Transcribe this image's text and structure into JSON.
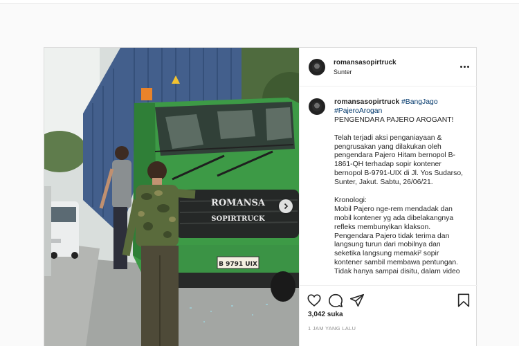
{
  "post": {
    "username": "romansasopirtruck",
    "location": "Sunter",
    "caption": {
      "username": "romansasopirtruck",
      "hashtags": [
        "#BangJago",
        "#PajeroArogan"
      ],
      "lines": [
        "PENGENDARA PAJERO AROGANT!",
        "",
        "Telah terjadi aksi penganiayaan &",
        "pengrusakan yang dilakukan oleh",
        "pengendara Pajero Hitam bernopol B-",
        "1861-QH terhadap sopir kontener",
        "bernopol B-9791-UIX di Jl. Yos Sudarso,",
        "Sunter, Jakut. Sabtu, 26/06/21.",
        "",
        "Kronologi:",
        "Mobil Pajero nge-rem mendadak dan",
        "mobil kontener yg ada dibelakangnya",
        "refleks membunyikan klakson.",
        "Pengendara Pajero tidak terima dan",
        "langsung turun dari mobilnya dan",
        "seketika langsung memaki² sopir",
        "kontener sambil membawa pentungan.",
        "Tidak hanya sampai disitu, dalam video"
      ]
    },
    "likes": "3,042 suka",
    "time_ago": "1 JAM YANG LALU",
    "image": {
      "truck_logo_line1": "ROMANSA",
      "truck_logo_line2": "SOPIRTRUCK",
      "plate": "B 9791 UIX"
    },
    "icons": {
      "more": "more-options-icon",
      "like": "heart-icon",
      "comment": "comment-icon",
      "share": "share-icon",
      "save": "bookmark-icon",
      "next": "chevron-right-icon"
    }
  }
}
